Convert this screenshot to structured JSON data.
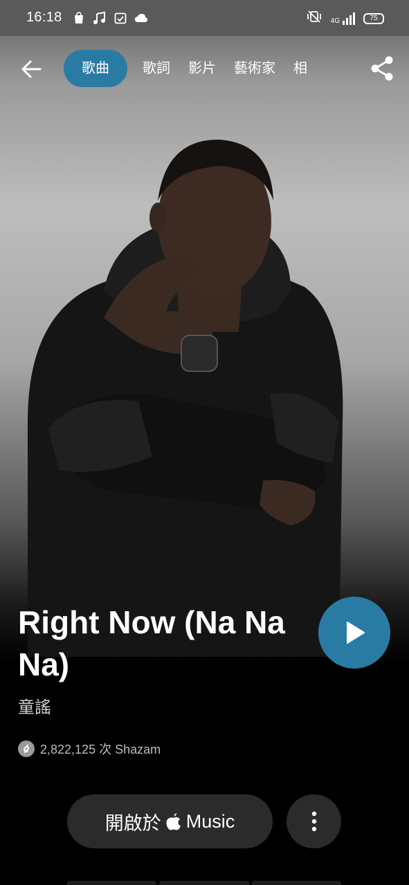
{
  "status_bar": {
    "time": "16:18",
    "battery": "75",
    "network": "4G",
    "icons_left": [
      "shopping-bag-icon",
      "music-note-icon",
      "calendar-check-icon",
      "cloud-icon"
    ],
    "icons_right": [
      "vibrate-icon",
      "signal-icon",
      "battery-icon"
    ]
  },
  "nav": {
    "tabs": [
      {
        "label": "歌曲",
        "active": true
      },
      {
        "label": "歌詞",
        "active": false
      },
      {
        "label": "影片",
        "active": false
      },
      {
        "label": "藝術家",
        "active": false
      },
      {
        "label": "相",
        "active": false
      }
    ]
  },
  "song": {
    "title": "Right Now (Na Na Na)",
    "artist": "童謠",
    "shazam_count": "2,822,125 次 Shazam"
  },
  "actions": {
    "open_in_prefix": "開啟於",
    "open_in_service": "Music"
  },
  "colors": {
    "accent": "#2a7ba4",
    "button_bg": "#2b2b2b"
  }
}
